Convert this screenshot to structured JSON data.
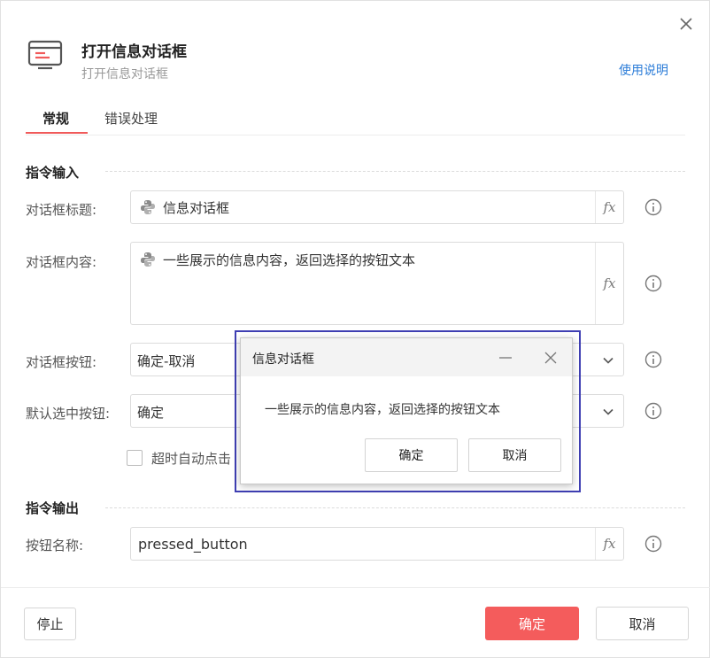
{
  "header": {
    "title": "打开信息对话框",
    "subtitle": "打开信息对话框",
    "help_link": "使用说明"
  },
  "tabs": [
    {
      "label": "常规",
      "active": true
    },
    {
      "label": "错误处理",
      "active": false
    }
  ],
  "sections": {
    "input_title": "指令输入",
    "output_title": "指令输出"
  },
  "fields": {
    "dialog_title": {
      "label": "对话框标题:",
      "value": "信息对话框"
    },
    "dialog_content": {
      "label": "对话框内容:",
      "value": "一些展示的信息内容，返回选择的按钮文本"
    },
    "dialog_buttons": {
      "label": "对话框按钮:",
      "value": "确定-取消"
    },
    "default_button": {
      "label": "默认选中按钮:",
      "value": "确定"
    },
    "timeout_checkbox": {
      "label": "超时自动点击",
      "checked": false
    },
    "button_name": {
      "label": "按钮名称:",
      "value": "pressed_button"
    }
  },
  "fx_label": "fx",
  "footer": {
    "stop": "停止",
    "ok": "确定",
    "cancel": "取消"
  },
  "preview": {
    "title": "信息对话框",
    "message": "一些展示的信息内容，返回选择的按钮文本",
    "ok": "确定",
    "cancel": "取消"
  },
  "colors": {
    "accent": "#f45c5c",
    "link": "#2b7cd8",
    "preview_border": "#3f3fb3"
  }
}
